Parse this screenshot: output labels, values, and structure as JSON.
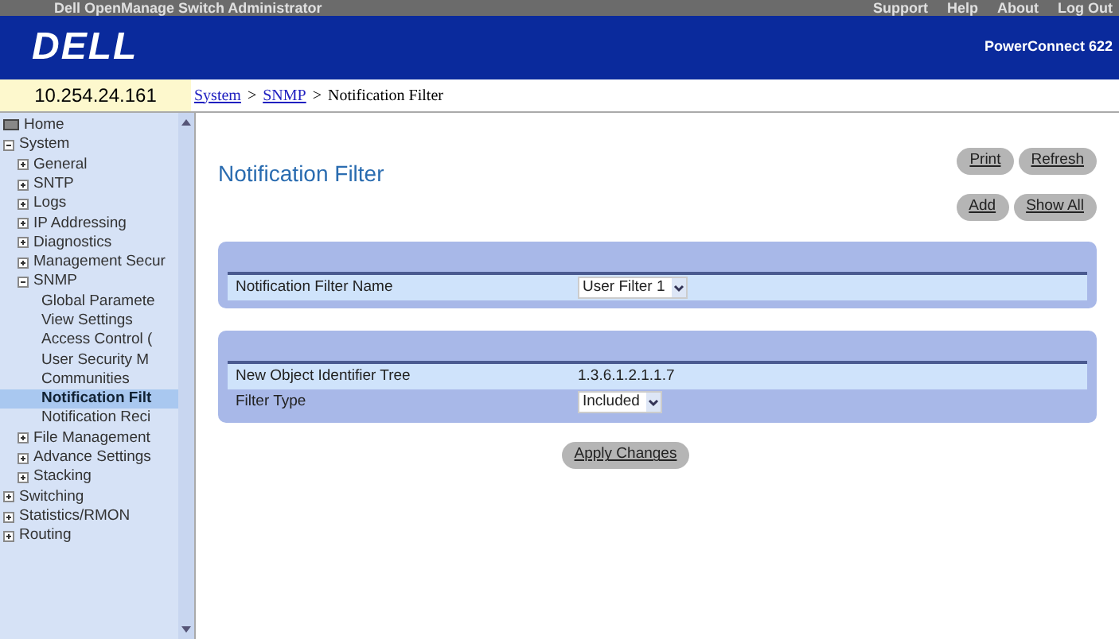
{
  "top_bar": {
    "title": "Dell OpenManage Switch Administrator",
    "links": [
      "Support",
      "Help",
      "About",
      "Log Out"
    ]
  },
  "header": {
    "logo": "DELL",
    "product": "PowerConnect 622"
  },
  "ip_address": "10.254.24.161",
  "breadcrumb": {
    "separator": ">",
    "items": [
      {
        "label": "System",
        "link": true
      },
      {
        "label": "SNMP",
        "link": true
      },
      {
        "label": "Notification Filter",
        "link": false
      }
    ]
  },
  "sidebar": {
    "items": [
      {
        "label": "Home",
        "kind": "root",
        "selected": false
      },
      {
        "label": "System",
        "kind": "folder",
        "expanded": true,
        "selected": false,
        "children": [
          {
            "label": "General",
            "kind": "folder",
            "expanded": false,
            "selected": false
          },
          {
            "label": "SNTP",
            "kind": "folder",
            "expanded": false,
            "selected": false
          },
          {
            "label": "Logs",
            "kind": "folder",
            "expanded": false,
            "selected": false
          },
          {
            "label": "IP Addressing",
            "kind": "folder",
            "expanded": false,
            "selected": false
          },
          {
            "label": "Diagnostics",
            "kind": "folder",
            "expanded": false,
            "selected": false
          },
          {
            "label": "Management Secur",
            "kind": "folder",
            "expanded": false,
            "selected": false
          },
          {
            "label": "SNMP",
            "kind": "folder",
            "expanded": true,
            "selected": false,
            "children": [
              {
                "label": "Global Paramete",
                "kind": "page",
                "selected": false
              },
              {
                "label": "View Settings",
                "kind": "page",
                "selected": false
              },
              {
                "label": "Access Control (",
                "kind": "page",
                "selected": false
              },
              {
                "label": "User Security M",
                "kind": "page",
                "selected": false
              },
              {
                "label": "Communities",
                "kind": "page",
                "selected": false
              },
              {
                "label": "Notification Filt",
                "kind": "page",
                "selected": true
              },
              {
                "label": "Notification Reci",
                "kind": "page",
                "selected": false
              }
            ]
          },
          {
            "label": "File Management",
            "kind": "folder",
            "expanded": false,
            "selected": false
          },
          {
            "label": "Advance Settings",
            "kind": "folder",
            "expanded": false,
            "selected": false
          },
          {
            "label": "Stacking",
            "kind": "folder",
            "expanded": false,
            "selected": false
          }
        ]
      },
      {
        "label": "Switching",
        "kind": "folder",
        "expanded": false,
        "selected": false
      },
      {
        "label": "Statistics/RMON",
        "kind": "folder",
        "expanded": false,
        "selected": false
      },
      {
        "label": "Routing",
        "kind": "folder",
        "expanded": false,
        "selected": false
      }
    ]
  },
  "page": {
    "title": "Notification Filter",
    "buttons_row_1": [
      "Print",
      "Refresh"
    ],
    "buttons_row_2": [
      "Add",
      "Show All"
    ],
    "panels": [
      {
        "rows": [
          {
            "label": "Notification Filter Name",
            "kind": "select",
            "value": "User Filter 1"
          }
        ]
      },
      {
        "rows": [
          {
            "label": "New Object Identifier Tree",
            "kind": "text",
            "value": "1.3.6.1.2.1.1.7"
          },
          {
            "label": "Filter Type",
            "kind": "select",
            "value": "Included"
          }
        ]
      }
    ],
    "apply_button": "Apply Changes"
  }
}
